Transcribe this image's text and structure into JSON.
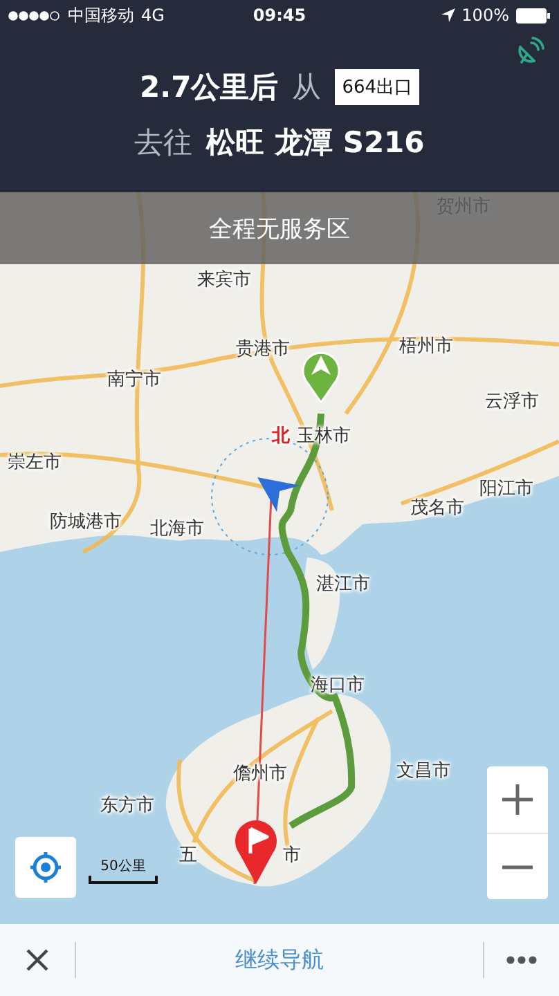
{
  "status_bar": {
    "carrier": "中国移动",
    "network": "4G",
    "time": "09:45",
    "battery": "100%"
  },
  "guidance": {
    "distance": "2.7公里后",
    "from_word": "从",
    "exit": "664出口",
    "to_word": "去往",
    "destination": "松旺 龙潭 S216"
  },
  "banner": "全程无服务区",
  "map": {
    "labels": [
      {
        "text": "贺州市",
        "kind": "city"
      },
      {
        "text": "来宾市",
        "kind": "city"
      },
      {
        "text": "梧州市",
        "kind": "city"
      },
      {
        "text": "贵港市",
        "kind": "city"
      },
      {
        "text": "南宁市",
        "kind": "city"
      },
      {
        "text": "云浮市",
        "kind": "city"
      },
      {
        "text": "北",
        "kind": "compass"
      },
      {
        "text": "玉林市",
        "kind": "city"
      },
      {
        "text": "崇左市",
        "kind": "city"
      },
      {
        "text": "阳江市",
        "kind": "city"
      },
      {
        "text": "茂名市",
        "kind": "city"
      },
      {
        "text": "防城港市",
        "kind": "city"
      },
      {
        "text": "北海市",
        "kind": "city"
      },
      {
        "text": "湛江市",
        "kind": "city"
      },
      {
        "text": "海口市",
        "kind": "city"
      },
      {
        "text": "儋州市",
        "kind": "city"
      },
      {
        "text": "文昌市",
        "kind": "city"
      },
      {
        "text": "东方市",
        "kind": "city"
      },
      {
        "text": "五",
        "kind": "city"
      },
      {
        "text": "市",
        "kind": "city"
      }
    ],
    "scale": "50公里"
  },
  "bottom_bar": {
    "action": "继续导航"
  }
}
